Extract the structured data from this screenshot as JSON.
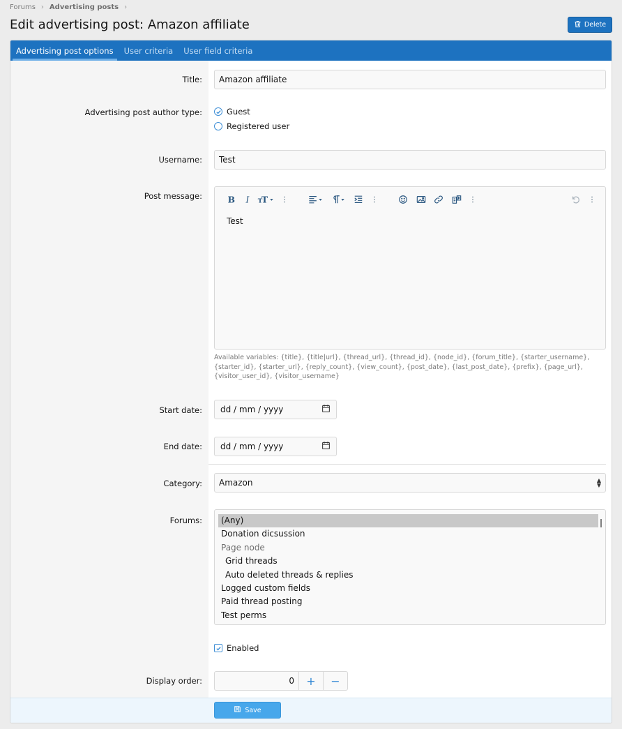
{
  "breadcrumb": [
    "Forums",
    "Advertising posts"
  ],
  "page_title": "Edit advertising post: Amazon affiliate",
  "delete_label": "Delete",
  "tabs": [
    "Advertising post options",
    "User criteria",
    "User field criteria"
  ],
  "fields": {
    "title_label": "Title:",
    "title_value": "Amazon affiliate",
    "author_type_label": "Advertising post author type:",
    "author_options": [
      "Guest",
      "Registered user"
    ],
    "author_selected": "Guest",
    "username_label": "Username:",
    "username_value": "Test",
    "message_label": "Post message:",
    "message_value": "Test",
    "variables_hint": "Available variables: {title}, {title|url}, {thread_url}, {thread_id}, {node_id}, {forum_title}, {starter_username}, {starter_id}, {starter_url}, {reply_count}, {view_count}, {post_date}, {last_post_date}, {prefix}, {page_url}, {visitor_user_id}, {visitor_username}",
    "start_date_label": "Start date:",
    "start_date_placeholder": "dd / mm / yyyy",
    "end_date_label": "End date:",
    "end_date_placeholder": "dd / mm / yyyy",
    "category_label": "Category:",
    "category_value": "Amazon",
    "forums_label": "Forums:",
    "forums_options": [
      "(Any)",
      "Donation dicsussion",
      "Page node",
      "Grid threads",
      "Auto deleted threads & replies",
      "Logged custom fields",
      "Paid thread posting",
      "Test perms"
    ],
    "enabled_label": "Enabled",
    "display_order_label": "Display order:",
    "display_order_value": "0"
  },
  "save_label": "Save",
  "colors": {
    "accent": "#1d72c0",
    "save": "#47a7eb",
    "footer": "#edf6fd"
  }
}
